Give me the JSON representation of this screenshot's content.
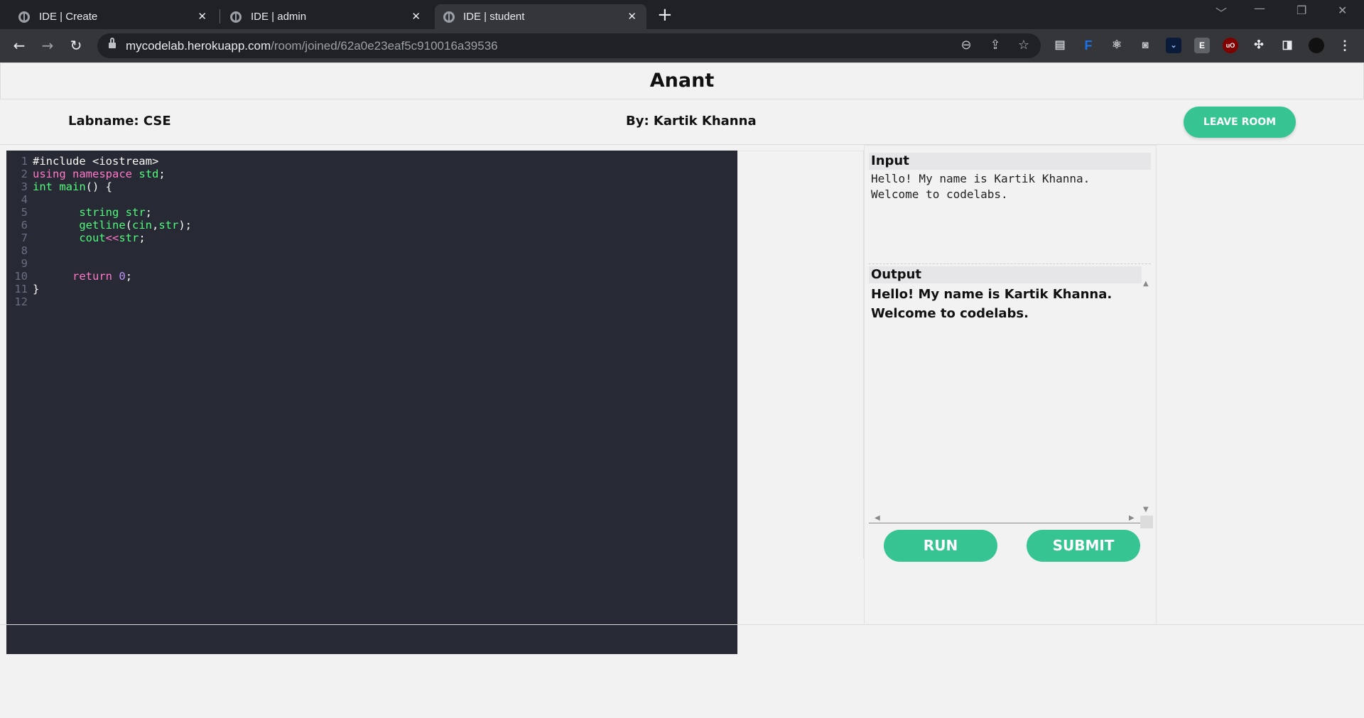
{
  "browser": {
    "tabs": [
      {
        "title": "IDE | Create",
        "close": "✕",
        "active": false
      },
      {
        "title": "IDE | admin",
        "close": "✕",
        "active": false
      },
      {
        "title": "IDE | student",
        "close": "✕",
        "active": true
      }
    ],
    "new_tab": "+",
    "url_host": "mycodelab.herokuapp.com",
    "url_path": "/room/joined/62a0e23eaf5c910016a39536",
    "icons": [
      "back-icon",
      "forward-icon",
      "reload-icon",
      "zoom-icon",
      "share-icon",
      "star-icon"
    ]
  },
  "room": {
    "title": "Anant",
    "labname": "Labname: CSE",
    "by": "By: Kartik Khanna",
    "leave_label": "LEAVE ROOM"
  },
  "editor": {
    "lines": [
      {
        "n": "1",
        "text": "#include <iostream>"
      },
      {
        "n": "2",
        "text": "using namespace std;"
      },
      {
        "n": "3",
        "text": "int main() {"
      },
      {
        "n": "4",
        "text": ""
      },
      {
        "n": "5",
        "text": "       string str;"
      },
      {
        "n": "6",
        "text": "       getline(cin,str);"
      },
      {
        "n": "7",
        "text": "       cout<<str;"
      },
      {
        "n": "8",
        "text": ""
      },
      {
        "n": "9",
        "text": ""
      },
      {
        "n": "10",
        "text": "      return 0;"
      },
      {
        "n": "11",
        "text": "}"
      },
      {
        "n": "12",
        "text": ""
      }
    ]
  },
  "io": {
    "input_label": "Input",
    "input_text": "Hello! My name is Kartik Khanna.\nWelcome to codelabs.",
    "output_label": "Output",
    "output_line1": "Hello! My name is Kartik Khanna.",
    "output_line2": "Welcome to codelabs.",
    "run_label": "RUN",
    "submit_label": "SUBMIT"
  },
  "colors": {
    "accent": "#35c492",
    "editor_bg": "#272935",
    "keyword": "#ff79c6",
    "type": "#50fa7b",
    "number": "#bd93f9"
  }
}
